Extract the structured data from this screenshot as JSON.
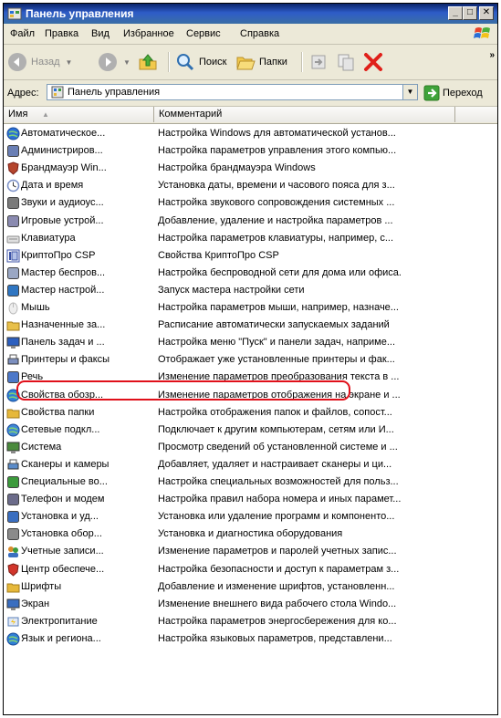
{
  "window": {
    "title": "Панель управления"
  },
  "menu": [
    {
      "label": "Файл",
      "ul": "Ф"
    },
    {
      "label": "Правка",
      "ul": "П"
    },
    {
      "label": "Вид",
      "ul": "В"
    },
    {
      "label": "Избранное",
      "ul": "И"
    },
    {
      "label": "Сервис",
      "ul": "С"
    },
    {
      "label": "Справка",
      "ul": "С"
    }
  ],
  "toolbar": {
    "back": "Назад",
    "search": "Поиск",
    "folders": "Папки"
  },
  "address": {
    "label": "Адрес:",
    "value": "Панель управления",
    "go": "Переход"
  },
  "columns": {
    "name": "Имя",
    "comment": "Комментарий"
  },
  "items": [
    {
      "name": "Автоматическое...",
      "comment": "Настройка Windows для автоматической установ...",
      "icon": "globe",
      "color": "#2a6fd6"
    },
    {
      "name": "Администриров...",
      "comment": "Настройка параметров управления этого компью...",
      "icon": "admin-tools",
      "color": "#6a7fb5"
    },
    {
      "name": "Брандмауэр Win...",
      "comment": "Настройка брандмауэра Windows",
      "icon": "firewall",
      "color": "#b5452d"
    },
    {
      "name": "Дата и время",
      "comment": "Установка даты, времени и часового пояса для з...",
      "icon": "clock",
      "color": "#7a8fc7"
    },
    {
      "name": "Звуки и аудиоус...",
      "comment": "Настройка звукового сопровождения системных ...",
      "icon": "speaker",
      "color": "#7a7a7a"
    },
    {
      "name": "Игровые устрой...",
      "comment": "Добавление, удаление и настройка параметров ...",
      "icon": "joystick",
      "color": "#8a8ab0"
    },
    {
      "name": "Клавиатура",
      "comment": "Настройка параметров клавиатуры, например, с...",
      "icon": "keyboard",
      "color": "#8d8d8d"
    },
    {
      "name": "КриптоПро CSP",
      "comment": "Свойства КриптоПро CSP",
      "icon": "cryptopro",
      "color": "#3b52a6"
    },
    {
      "name": "Мастер беспров...",
      "comment": "Настройка беспроводной сети для дома или офиса.",
      "icon": "wireless",
      "color": "#9aa7c4"
    },
    {
      "name": "Мастер настрой...",
      "comment": "Запуск мастера настройки сети",
      "icon": "network-wizard",
      "color": "#2f76c2"
    },
    {
      "name": "Мышь",
      "comment": "Настройка параметров мыши, например, назначе...",
      "icon": "mouse",
      "color": "#b9b9b9"
    },
    {
      "name": "Назначенные за...",
      "comment": "Расписание автоматически запускаемых заданий",
      "icon": "task-folder",
      "color": "#e8c04a"
    },
    {
      "name": "Панель задач и ...",
      "comment": "Настройка меню \"Пуск\" и панели задач, наприме...",
      "icon": "taskbar",
      "color": "#2c5fbf"
    },
    {
      "name": "Принтеры и факсы",
      "comment": "Отображает уже установленные принтеры и фак...",
      "icon": "printer",
      "color": "#7c8fbf"
    },
    {
      "name": "Речь",
      "comment": "Изменение параметров преобразования текста в ...",
      "icon": "speech",
      "color": "#4c78c9"
    },
    {
      "name": "Свойства обозр...",
      "comment": "Изменение параметров отображения на экране и ...",
      "icon": "ie-globe",
      "color": "#2f7fd6"
    },
    {
      "name": "Свойства папки",
      "comment": "Настройка отображения папок и файлов, сопост...",
      "icon": "folder-options",
      "color": "#e6b83a"
    },
    {
      "name": "Сетевые подкл...",
      "comment": "Подключает к другим компьютерам, сетям или И...",
      "icon": "network-globe",
      "color": "#3f86d6"
    },
    {
      "name": "Система",
      "comment": "Просмотр сведений об установленной системе и ...",
      "icon": "system",
      "color": "#4a8a3c"
    },
    {
      "name": "Сканеры и камеры",
      "comment": "Добавляет, удаляет и настраивает сканеры и ци...",
      "icon": "scanner",
      "color": "#5a8bc9"
    },
    {
      "name": "Специальные во...",
      "comment": "Настройка специальных возможностей для польз...",
      "icon": "accessibility",
      "color": "#3c9a3c"
    },
    {
      "name": "Телефон и модем",
      "comment": "Настройка правил набора номера и иных парамет...",
      "icon": "phone",
      "color": "#6b6b8a"
    },
    {
      "name": "Установка и уд...",
      "comment": "Установка или удаление программ и компоненто...",
      "icon": "add-remove",
      "color": "#3a6ec0"
    },
    {
      "name": "Установка обор...",
      "comment": "Установка и диагностика оборудования",
      "icon": "hardware",
      "color": "#8a8a8a"
    },
    {
      "name": "Учетные записи...",
      "comment": "Изменение параметров и паролей учетных запис...",
      "icon": "users",
      "color": "#d98b2b"
    },
    {
      "name": "Центр обеспече...",
      "comment": "Настройка безопасности и доступ к параметрам з...",
      "icon": "shield",
      "color": "#d1352b"
    },
    {
      "name": "Шрифты",
      "comment": "Добавление и изменение шрифтов, установленн...",
      "icon": "fonts-folder",
      "color": "#e6b83a"
    },
    {
      "name": "Экран",
      "comment": "Изменение внешнего вида рабочего стола Windo...",
      "icon": "display",
      "color": "#3a6ec0"
    },
    {
      "name": "Электропитание",
      "comment": "Настройка параметров энергосбережения для ко...",
      "icon": "power",
      "color": "#5a7fb8"
    },
    {
      "name": "Язык и регионa...",
      "comment": "Настройка языковых параметров, представлени...",
      "icon": "language-globe",
      "color": "#2f7fd6"
    }
  ]
}
